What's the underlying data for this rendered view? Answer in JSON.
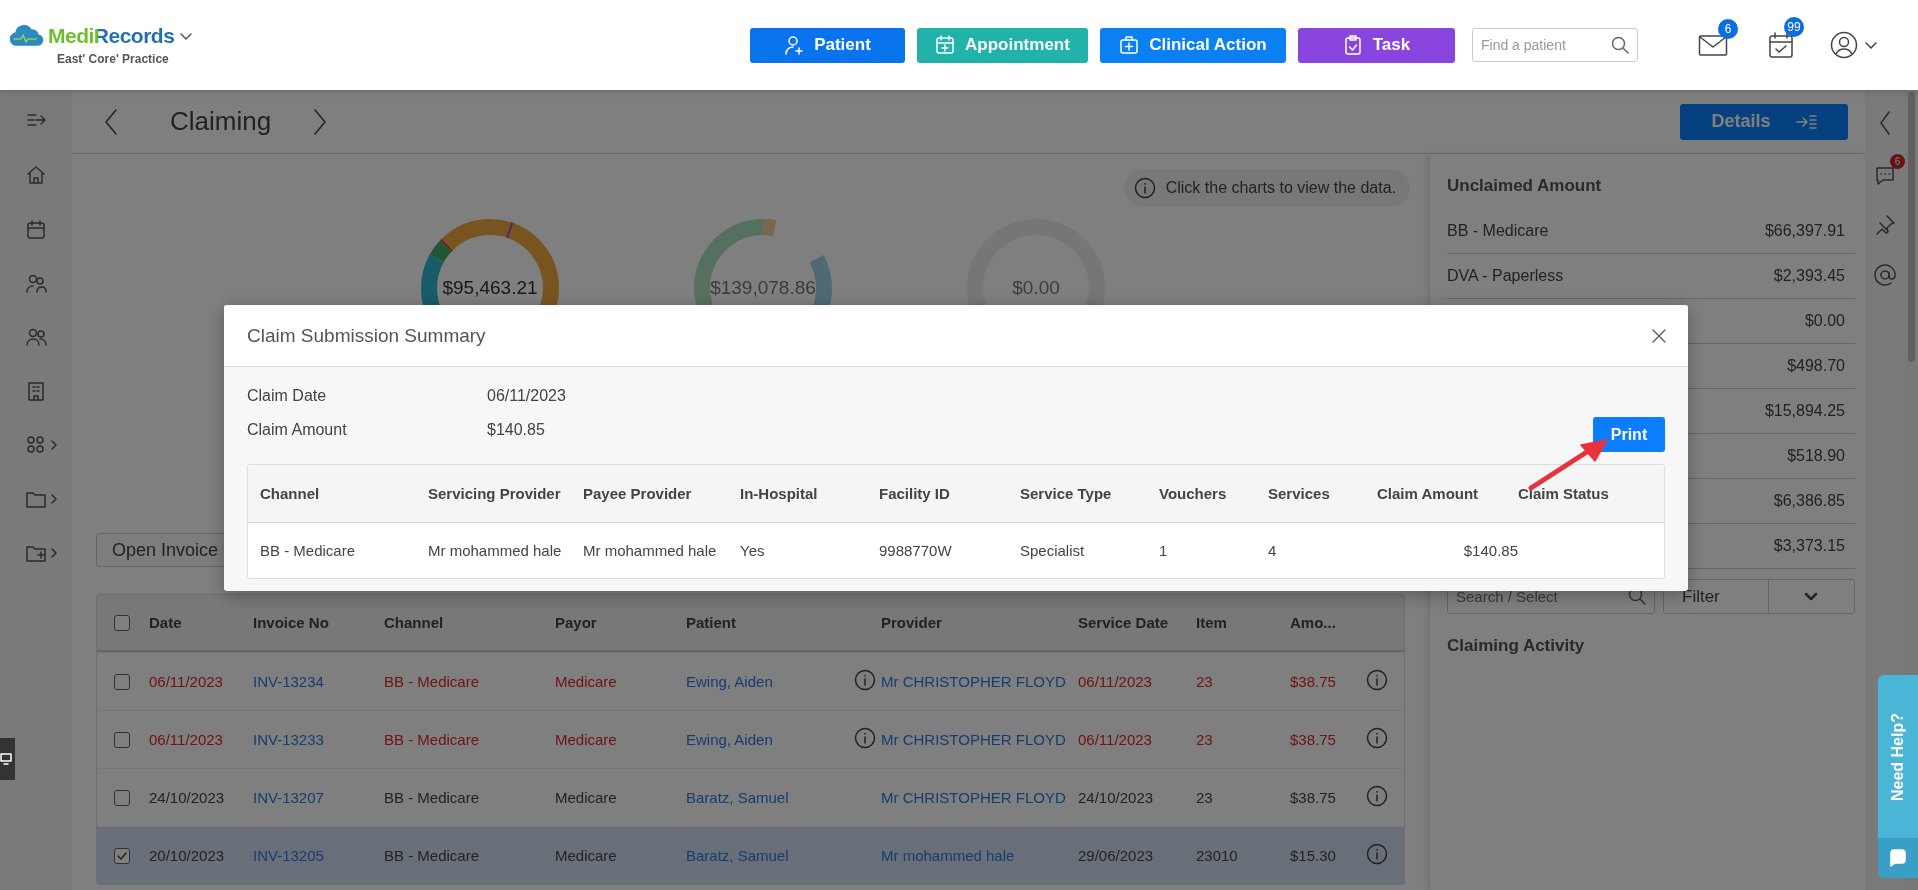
{
  "header": {
    "brand": "MediRecords",
    "practice": "East' Core' Practice",
    "actions": [
      {
        "label": "Patient",
        "kind": "patient"
      },
      {
        "label": "Appointment",
        "kind": "appointment"
      },
      {
        "label": "Clinical Action",
        "kind": "clinical"
      },
      {
        "label": "Task",
        "kind": "task"
      }
    ],
    "search": {
      "placeholder": "Find a patient"
    },
    "mail_badge": "6",
    "calendar_badge": "99"
  },
  "page": {
    "title": "Claiming",
    "details_button": "Details",
    "hint": "Click the charts to view the data.",
    "donut_totals": [
      "$95,463.21",
      "$139,078.86",
      "$0.00"
    ],
    "open_invoice": "Open Invoice"
  },
  "invoices": {
    "columns": [
      "Date",
      "Invoice No",
      "Channel",
      "Payor",
      "Patient",
      "Provider",
      "Service Date",
      "Item",
      "Amo..."
    ],
    "all_checked": false,
    "rows": [
      {
        "checked": false,
        "selected": false,
        "alert": true,
        "patient_info": true,
        "cells": [
          "06/11/2023",
          "INV-13234",
          "BB - Medicare",
          "Medicare",
          "Ewing, Aiden",
          "Mr CHRISTOPHER FLOYD",
          "06/11/2023",
          "23",
          "$38.75"
        ]
      },
      {
        "checked": false,
        "selected": false,
        "alert": true,
        "patient_info": true,
        "cells": [
          "06/11/2023",
          "INV-13233",
          "BB - Medicare",
          "Medicare",
          "Ewing, Aiden",
          "Mr CHRISTOPHER FLOYD",
          "06/11/2023",
          "23",
          "$38.75"
        ]
      },
      {
        "checked": false,
        "selected": false,
        "alert": false,
        "patient_info": false,
        "cells": [
          "24/10/2023",
          "INV-13207",
          "BB - Medicare",
          "Medicare",
          "Baratz, Samuel",
          "Mr CHRISTOPHER FLOYD",
          "24/10/2023",
          "23",
          "$38.75"
        ]
      },
      {
        "checked": true,
        "selected": true,
        "alert": false,
        "patient_info": false,
        "cells": [
          "20/10/2023",
          "INV-13205",
          "BB - Medicare",
          "Medicare",
          "Baratz, Samuel",
          "Mr mohammed hale",
          "29/06/2023",
          "23010",
          "$15.30"
        ]
      }
    ]
  },
  "unclaimed": {
    "title": "Unclaimed Amount",
    "rows": [
      {
        "label": "BB - Medicare",
        "amount": "$66,397.91"
      },
      {
        "label": "DVA - Paperless",
        "amount": "$2,393.45"
      },
      {
        "amount": "$0.00"
      },
      {
        "amount": "$498.70"
      },
      {
        "amount": "$15,894.25"
      },
      {
        "amount": "$518.90"
      },
      {
        "amount": "$6,386.85"
      },
      {
        "amount": "$3,373.15"
      }
    ],
    "search": {
      "placeholder": "Search / Select"
    },
    "filter": "Filter",
    "activity_title": "Claiming Activity"
  },
  "rail": {
    "chat_badge": "6"
  },
  "help": {
    "label": "Need Help?"
  },
  "modal": {
    "title": "Claim Submission Summary",
    "fields": [
      {
        "label": "Claim Date",
        "value": "06/11/2023"
      },
      {
        "label": "Claim Amount",
        "value": "$140.85"
      }
    ],
    "print": "Print",
    "columns": [
      "Channel",
      "Servicing Provider",
      "Payee Provider",
      "In-Hospital",
      "Facility ID",
      "Service Type",
      "Vouchers",
      "Services",
      "Claim Amount",
      "Claim Status"
    ],
    "rows": [
      [
        "BB - Medicare",
        "Mr mohammed hale",
        "Mr mohammed hale",
        "Yes",
        "9988770W",
        "Specialist",
        "1",
        "4",
        "$140.85"
      ]
    ]
  }
}
